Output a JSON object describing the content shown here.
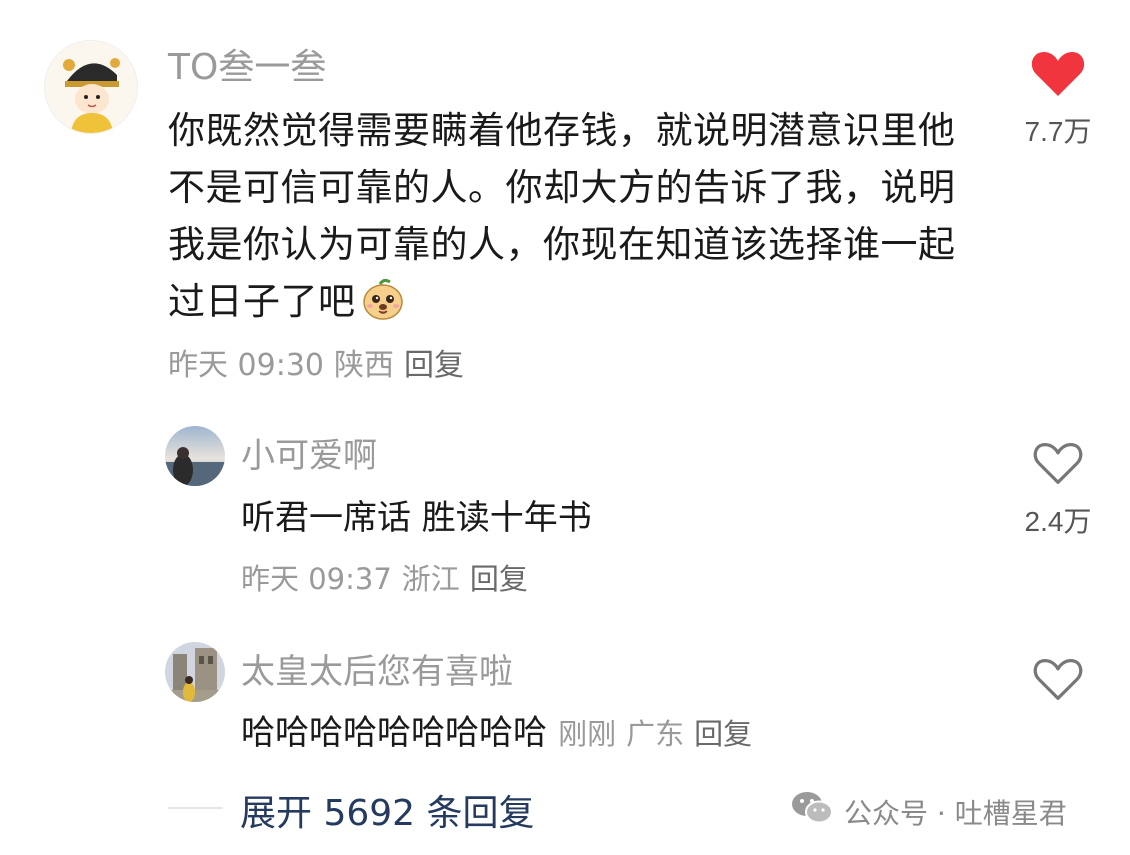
{
  "comment": {
    "username": "TO叁一叁",
    "text": "你既然觉得需要瞒着他存钱，就说明潜意识里他不是可信可靠的人。你却大方的告诉了我，说明我是你认为可靠的人，你现在知道该选择谁一起过日子了吧",
    "emoji": "smiling-dog-emoji",
    "time": "昨天 09:30",
    "location": "陕西",
    "reply_label": "回复",
    "like_count": "7.7万",
    "liked": true,
    "heart_color": "#f0353f"
  },
  "replies": [
    {
      "username": "小可爱啊",
      "text": "听君一席话 胜读十年书",
      "time": "昨天 09:37",
      "location": "浙江",
      "reply_label": "回复",
      "like_count": "2.4万",
      "liked": false
    },
    {
      "username": "太皇太后您有喜啦",
      "text": "哈哈哈哈哈哈哈哈哈",
      "time": "刚刚",
      "location": "广东",
      "reply_label": "回复",
      "like_count": "",
      "liked": false
    }
  ],
  "expand": {
    "label": "展开 5692 条回复"
  },
  "watermark": {
    "text": "公众号 · 吐槽星君"
  }
}
